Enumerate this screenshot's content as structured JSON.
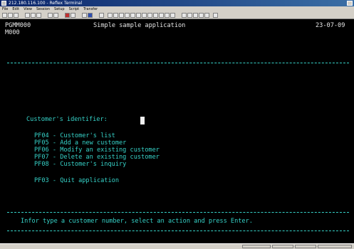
{
  "window": {
    "title": "212.180.116.100 - Reflex Terminal"
  },
  "menu": [
    "File",
    "Edit",
    "View",
    "Session",
    "Setup",
    "Script",
    "Transfer"
  ],
  "screen": {
    "program_id": "PGMM000",
    "map_id": "M000",
    "app_title": "Simple sample application",
    "date": "23-07-09",
    "field_label": "Customer's identifier:",
    "actions": [
      "PF04 - Customer's list",
      "PF05 - Add a new customer",
      "PF06 - Modify an existing customer",
      "PF07 - Delete an existing customer",
      "PF08 - Customer's inquiry"
    ],
    "quit": "PF03 - Quit application",
    "info": "Infor type a customer number, select an action and press Enter."
  }
}
